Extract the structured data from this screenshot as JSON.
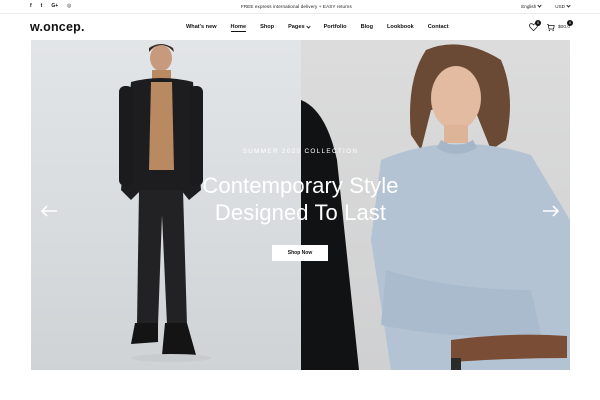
{
  "topbar": {
    "socials": [
      {
        "icon": "facebook-icon",
        "glyph": "f"
      },
      {
        "icon": "twitter-icon",
        "glyph": "t"
      },
      {
        "icon": "google-plus-icon",
        "glyph": "G+"
      },
      {
        "icon": "instagram-icon",
        "glyph": "◎"
      }
    ],
    "promo": "FREE express international delivery + EASY returns",
    "language": "English",
    "currency": "USD"
  },
  "header": {
    "logo": "w.oncep.",
    "nav": [
      {
        "label": "What's new"
      },
      {
        "label": "Home",
        "active": true
      },
      {
        "label": "Shop"
      },
      {
        "label": "Pages",
        "dropdown": true
      },
      {
        "label": "Portfolio"
      },
      {
        "label": "Blog"
      },
      {
        "label": "Lookbook"
      },
      {
        "label": "Contact"
      }
    ],
    "wishlist_count": "0",
    "cart_count": "0",
    "cart_total": "$00.0"
  },
  "hero": {
    "subtitle": "SUMMER 2020 COLLECTION",
    "title_line1": "Contemporary Style",
    "title_line2": "Designed To Last",
    "button": "Shop Now"
  },
  "colors": {
    "text": "#111111",
    "accent": "#111111",
    "hero_text": "#ffffff"
  }
}
